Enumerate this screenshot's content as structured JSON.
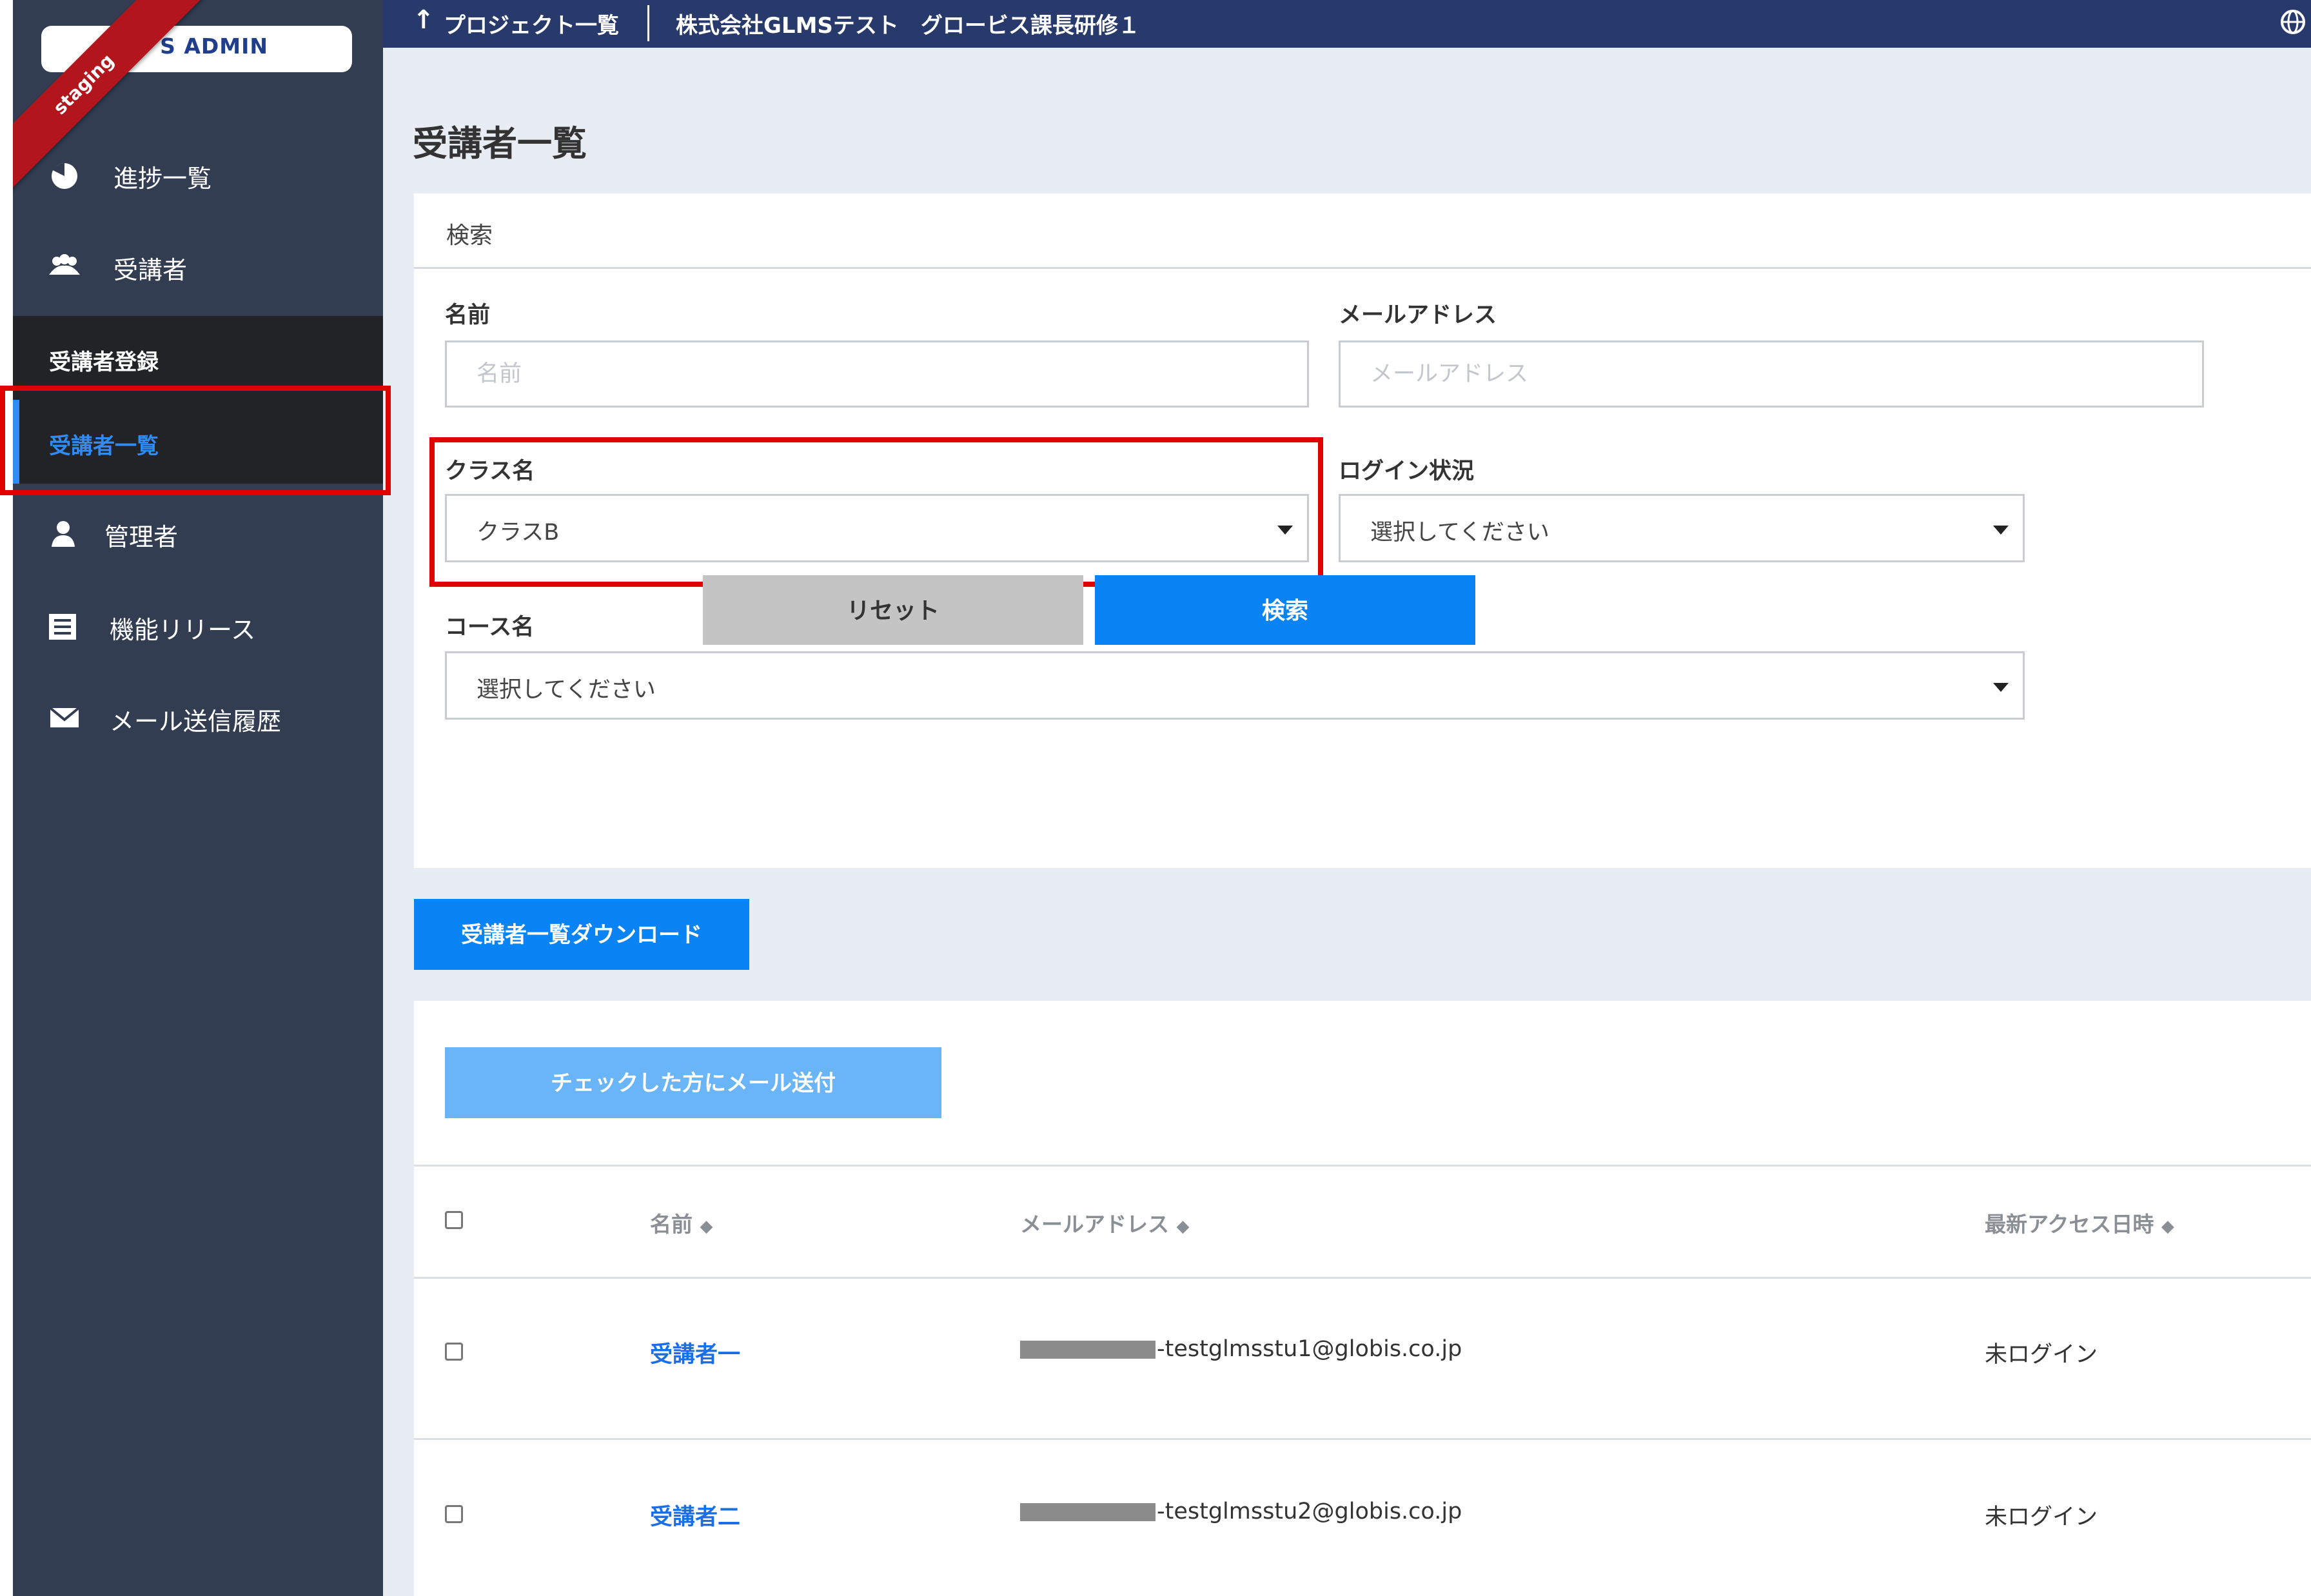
{
  "app": {
    "brand": "S ADMIN",
    "env_ribbon": "staging"
  },
  "topbar": {
    "back_arrow": "↑",
    "crumb_projects": "プロジェクト一覧",
    "crumb_project": "株式会社GLMSテスト　グロービス課長研修１",
    "globe_icon": "globe-icon"
  },
  "sidebar": {
    "items": [
      {
        "label": "進捗一覧",
        "icon": "pie-chart-icon"
      },
      {
        "label": "受講者",
        "icon": "users-icon"
      },
      {
        "label": "管理者",
        "icon": "user-icon"
      },
      {
        "label": "機能リリース",
        "icon": "document-icon"
      },
      {
        "label": "メール送信履歴",
        "icon": "envelope-icon"
      }
    ],
    "sub_items": [
      {
        "label": "受講者登録"
      },
      {
        "label": "受講者一覧",
        "active": true
      }
    ],
    "active_color": "#2f8bf5"
  },
  "page": {
    "title": "受講者一覧"
  },
  "search": {
    "header": "検索",
    "name_label": "名前",
    "name_placeholder": "名前",
    "email_label": "メールアドレス",
    "email_placeholder": "メールアドレス",
    "class_label": "クラス名",
    "class_value": "クラスB",
    "login_label": "ログイン状況",
    "login_value": "選択してください",
    "course_label": "コース名",
    "course_value": "選択してください",
    "reset_label": "リセット",
    "search_label": "検索"
  },
  "download_label": "受講者一覧ダウンロード",
  "list": {
    "mail_button_label": "チェックした方にメール送付",
    "columns": [
      {
        "label": "名前",
        "sort": "◆"
      },
      {
        "label": "メールアドレス",
        "sort": "◆"
      },
      {
        "label": "最新アクセス日時",
        "sort": "◆"
      }
    ],
    "rows": [
      {
        "name": "受講者一",
        "email": "-testglmsstu1@globis.co.jp",
        "last_access": "未ログイン"
      },
      {
        "name": "受講者二",
        "email": "-testglmsstu2@globis.co.jp",
        "last_access": "未ログイン"
      }
    ]
  },
  "colors": {
    "primary": "#0a84f5",
    "topbar": "#283a6b",
    "sidebar": "#323d52",
    "highlight": "#e00000"
  }
}
